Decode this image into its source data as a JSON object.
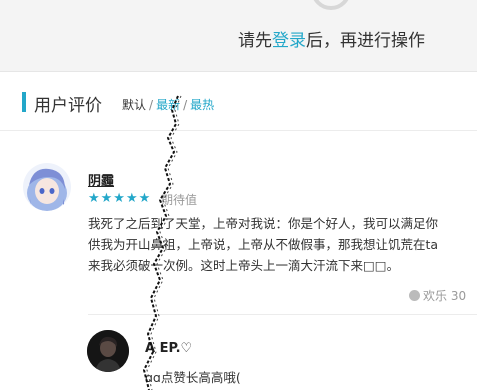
{
  "login_banner": {
    "prefix": "请先",
    "link": "登录",
    "suffix": "后，再进行操作"
  },
  "section": {
    "title": "用户评价",
    "sort_default": "默认",
    "sort_newest": "最新",
    "sort_hottest": "最热",
    "separator": "/"
  },
  "comments": [
    {
      "username": "阴霾",
      "stars": "★★★★★",
      "rating_label": "期待值",
      "lines": [
        "我死了之后到了天堂，上帝对我说：你是个好人，我可以满足你",
        "供我为开山鼻祖，上帝说，上帝从不做假事，那我想让饥荒在ta",
        "来我必须破一次例。这时上帝头上一滴大汗流下来□□。"
      ],
      "likes_label": "欢乐",
      "likes_count": "30"
    },
    {
      "username": "A EP.♡",
      "lines": [
        "ɑɑ点赞长高高哦("
      ]
    }
  ],
  "colors": {
    "accent": "#23a7c9",
    "banner_bg": "#f4f4f4",
    "text": "#333333",
    "muted": "#999999"
  },
  "icons": {
    "like": "smile-icon",
    "spinner": "loading-spinner-icon"
  }
}
